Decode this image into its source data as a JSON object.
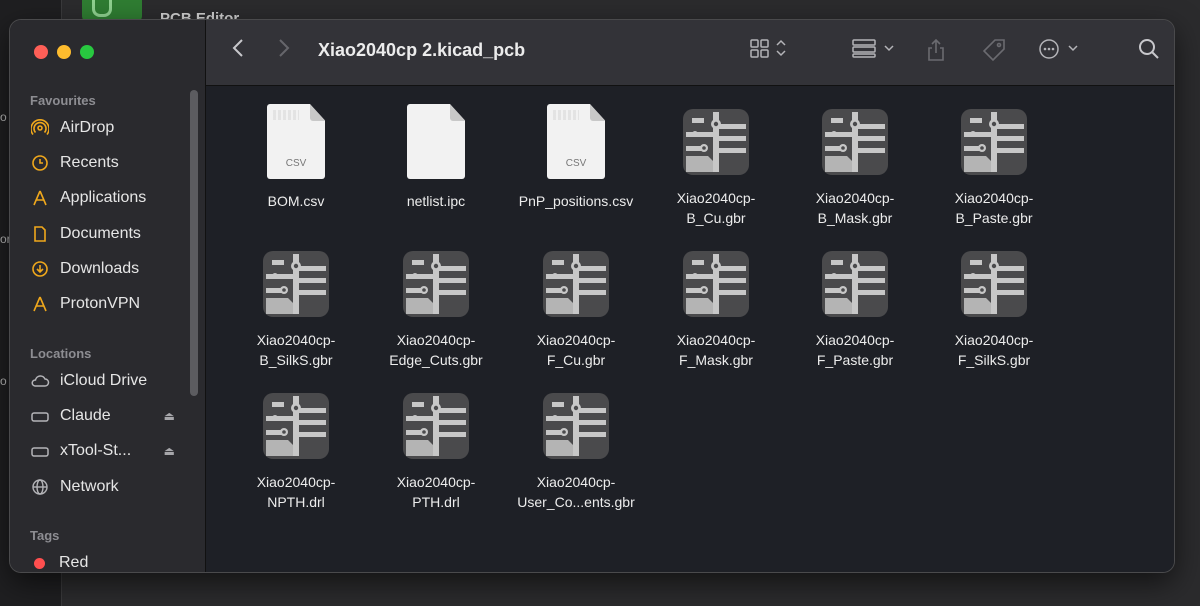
{
  "background": {
    "app_title": "PCB Editor",
    "left_strip_chars": [
      "o",
      "or",
      "o"
    ]
  },
  "window": {
    "title": "Xiao2040cp 2.kicad_pcb"
  },
  "sidebar": {
    "favourites_header": "Favourites",
    "favourites": [
      {
        "label": "AirDrop",
        "icon": "airdrop-icon"
      },
      {
        "label": "Recents",
        "icon": "clock-icon"
      },
      {
        "label": "Applications",
        "icon": "applications-icon"
      },
      {
        "label": "Documents",
        "icon": "document-icon"
      },
      {
        "label": "Downloads",
        "icon": "download-icon"
      },
      {
        "label": "ProtonVPN",
        "icon": "applications-icon"
      }
    ],
    "locations_header": "Locations",
    "locations": [
      {
        "label": "iCloud Drive",
        "icon": "cloud-icon"
      },
      {
        "label": "Claude",
        "icon": "drive-icon",
        "eject": true
      },
      {
        "label": "xTool-St...",
        "icon": "drive-icon",
        "eject": true
      },
      {
        "label": "Network",
        "icon": "globe-icon"
      }
    ],
    "tags_header": "Tags",
    "tags": [
      {
        "label": "Red",
        "color": "#ff4f4f"
      }
    ]
  },
  "files": [
    {
      "name": "BOM.csv",
      "kind": "csv"
    },
    {
      "name": "netlist.ipc",
      "kind": "doc"
    },
    {
      "name": "PnP_positions.csv",
      "kind": "csv"
    },
    {
      "name": "Xiao2040cp-\nB_Cu.gbr",
      "kind": "gerber"
    },
    {
      "name": "Xiao2040cp-\nB_Mask.gbr",
      "kind": "gerber"
    },
    {
      "name": "Xiao2040cp-\nB_Paste.gbr",
      "kind": "gerber"
    },
    {
      "name": "Xiao2040cp-\nB_SilkS.gbr",
      "kind": "gerber"
    },
    {
      "name": "Xiao2040cp-\nEdge_Cuts.gbr",
      "kind": "gerber"
    },
    {
      "name": "Xiao2040cp-\nF_Cu.gbr",
      "kind": "gerber"
    },
    {
      "name": "Xiao2040cp-\nF_Mask.gbr",
      "kind": "gerber"
    },
    {
      "name": "Xiao2040cp-\nF_Paste.gbr",
      "kind": "gerber"
    },
    {
      "name": "Xiao2040cp-\nF_SilkS.gbr",
      "kind": "gerber"
    },
    {
      "name": "Xiao2040cp-\nNPTH.drl",
      "kind": "gerber"
    },
    {
      "name": "Xiao2040cp-\nPTH.drl",
      "kind": "gerber"
    },
    {
      "name": "Xiao2040cp-\nUser_Co...ents.gbr",
      "kind": "gerber"
    }
  ],
  "csv_ext_label": "CSV",
  "colors": {
    "traffic_red": "#fe5f57",
    "traffic_yellow": "#febc2e",
    "traffic_green": "#28c840",
    "sidebar_accent": "#f0a81c",
    "tag_red": "#ff4f4f"
  }
}
